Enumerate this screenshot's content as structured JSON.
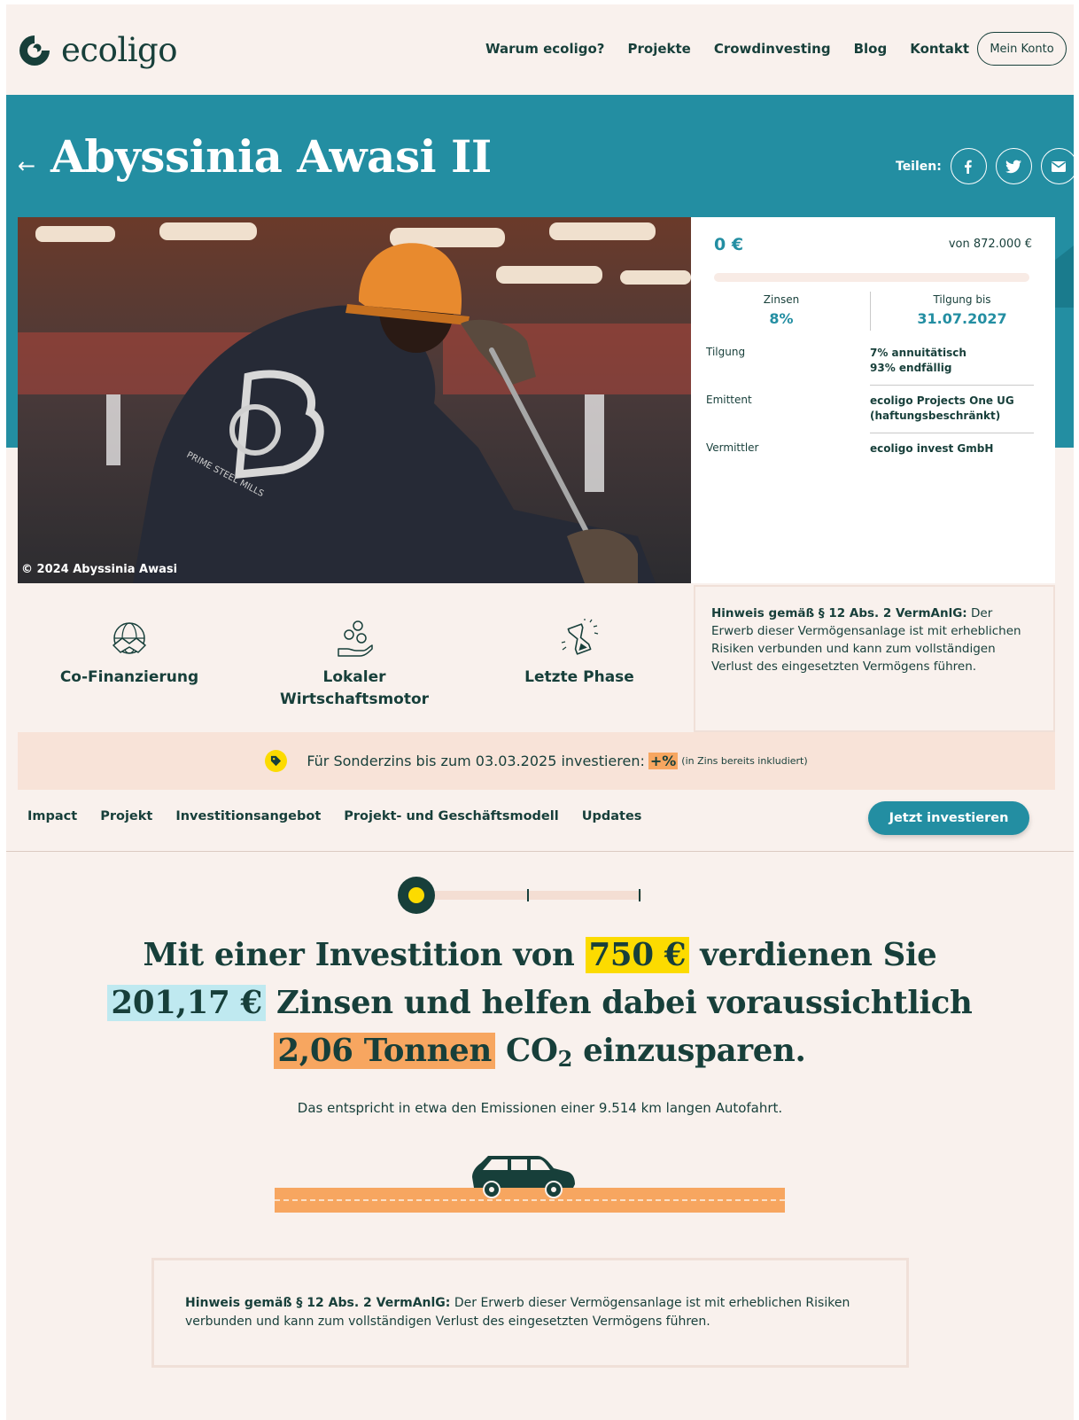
{
  "header": {
    "logo_text": "ecoligo",
    "nav": [
      "Warum ecoligo?",
      "Projekte",
      "Crowdinvesting",
      "Blog",
      "Kontakt"
    ],
    "account_label": "Mein Konto"
  },
  "project": {
    "title": "Abyssinia Awasi II",
    "share_label": "Teilen:",
    "share_icons": [
      "facebook-icon",
      "twitter-icon",
      "email-icon"
    ],
    "photo_credit": "© 2024 Abyssinia Awasi"
  },
  "funding": {
    "raised": "0 €",
    "goal": "von 872.000 €",
    "progress_fraction": 0,
    "interest_label": "Zinsen",
    "interest_value": "8%",
    "repayment_label": "Tilgung bis",
    "repayment_value": "31.07.2027",
    "details": [
      {
        "key": "Tilgung",
        "value_line1": "7% annuitätisch",
        "value_line2": "93% endfällig"
      },
      {
        "key": "Emittent",
        "value_line1": "ecoligo Projects One UG",
        "value_line2": "(haftungsbeschränkt)"
      },
      {
        "key": "Vermittler",
        "value_line1": "ecoligo invest GmbH",
        "value_line2": ""
      }
    ]
  },
  "features": [
    {
      "icon": "handshake-globe-icon",
      "label_line1": "Co-Finanzierung",
      "label_line2": ""
    },
    {
      "icon": "coins-hand-icon",
      "label_line1": "Lokaler",
      "label_line2": "Wirtschaftsmotor"
    },
    {
      "icon": "hourglass-icon",
      "label_line1": "Letzte Phase",
      "label_line2": ""
    }
  ],
  "notice": {
    "bold": "Hinweis gemäß § 12 Abs. 2 VermAnlG:",
    "text": " Der Erwerb dieser Vermögensanlage ist mit erheblichen Risiken verbunden und kann zum vollständigen Verlust des eingesetzten Vermögens führen."
  },
  "promo": {
    "text": "Für Sonderzins bis zum 03.03.2025 investieren:",
    "bonus": "+%",
    "note": "(in Zins bereits inkludiert)"
  },
  "tabs": [
    "Impact",
    "Projekt",
    "Investitionsangebot",
    "Projekt- und Geschäftsmodell",
    "Updates"
  ],
  "invest_button": "Jetzt investieren",
  "calculator": {
    "slider_position": 0,
    "text_1": "Mit einer Investition von",
    "investment": "750 €",
    "text_2": "verdienen Sie",
    "interest": "201,17 €",
    "text_3": "Zinsen und helfen dabei voraussichtlich",
    "co2": "2,06 Tonnen",
    "text_4": "CO",
    "text_4_sub": "2",
    "text_5": "einzusparen.",
    "emission_text": "Das entspricht in etwa den Emissionen einer 9.514 km langen Autofahrt."
  },
  "colors": {
    "teal": "#238ea2",
    "dark_green": "#173f3a",
    "cream": "#f9f1ed",
    "yellow": "#fcdb00",
    "orange": "#f7a660",
    "light_blue": "#bfe9f0"
  }
}
